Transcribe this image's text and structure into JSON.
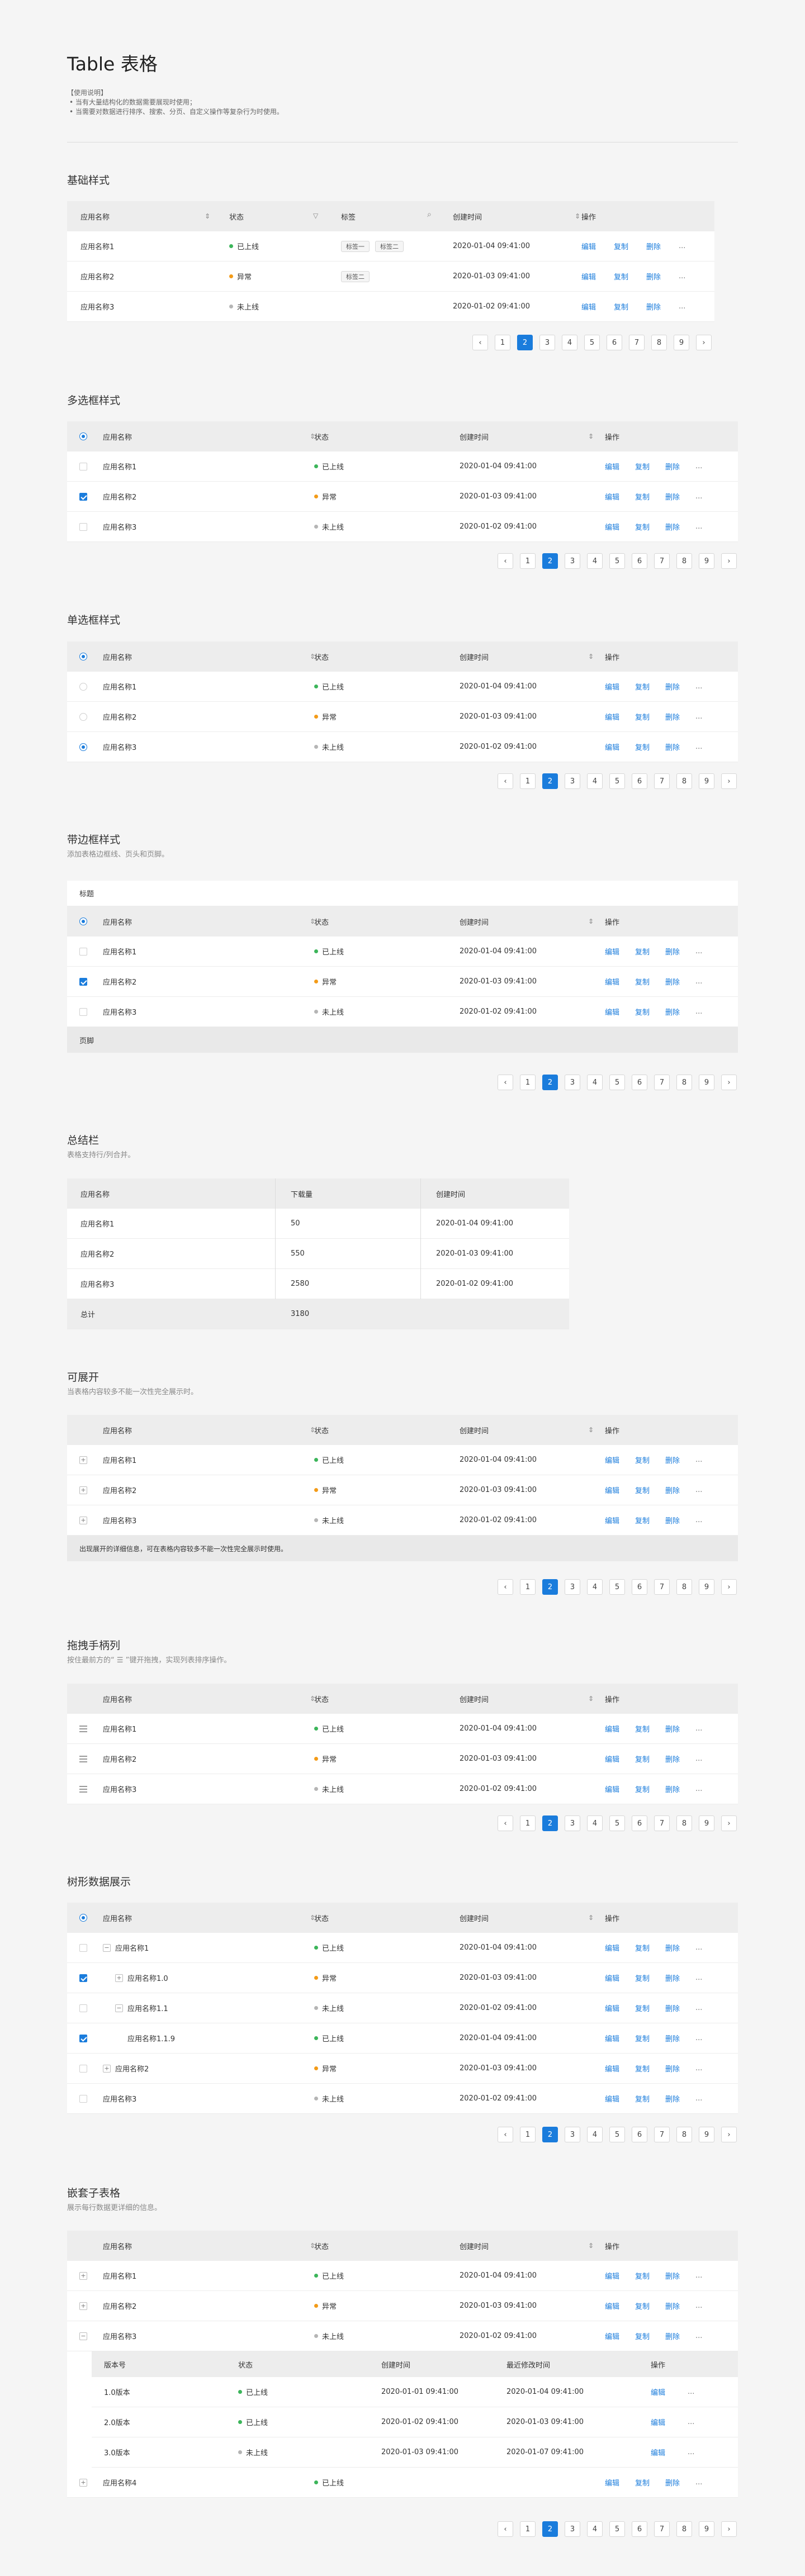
{
  "page": {
    "title": "Table 表格",
    "usage_header": "【使用说明】",
    "usage_items": [
      "• 当有大量结构化的数据需要展现时使用；",
      "• 当需要对数据进行排序、搜索、分页、自定义操作等复杂行为时使用。"
    ]
  },
  "columns": {
    "name": "应用名称",
    "status": "状态",
    "tags": "标签",
    "created": "创建时间",
    "actions": "操作",
    "downloads": "下载量",
    "version": "版本号",
    "last_modified": "最近修改时间"
  },
  "actions": {
    "edit": "编辑",
    "copy": "复制",
    "delete": "删除",
    "more": "..."
  },
  "status": {
    "online": "已上线",
    "error": "异常",
    "offline": "未上线"
  },
  "rows": [
    {
      "name": "应用名称1",
      "status": "已上线",
      "created": "2020-01-04  09:41:00"
    },
    {
      "name": "应用名称2",
      "status": "异常",
      "created": "2020-01-03  09:41:00"
    },
    {
      "name": "应用名称3",
      "status": "未上线",
      "created": "2020-01-02  09:41:00"
    }
  ],
  "tags": {
    "tag1": "标签一",
    "tag2": "标签二"
  },
  "pagination": [
    "1",
    "2",
    "3",
    "4",
    "5",
    "6",
    "7",
    "8",
    "9"
  ],
  "pagination_current": "2",
  "sections": {
    "basic": {
      "title": "基础样式"
    },
    "checkbox": {
      "title": "多选框样式"
    },
    "radio": {
      "title": "单选框样式"
    },
    "bordered": {
      "title": "带边框样式",
      "subtitle": "添加表格边框线、页头和页脚。",
      "caption": "标题",
      "footer": "页脚"
    },
    "summary": {
      "title": "总结栏",
      "subtitle": "表格支持行/列合并。",
      "rows": [
        {
          "name": "应用名称1",
          "downloads": "50",
          "created": "2020-01-04  09:41:00"
        },
        {
          "name": "应用名称2",
          "downloads": "550",
          "created": "2020-01-03  09:41:00"
        },
        {
          "name": "应用名称3",
          "downloads": "2580",
          "created": "2020-01-02  09:41:00"
        }
      ],
      "total_label": "总计",
      "total_value": "3180"
    },
    "expandable": {
      "title": "可展开",
      "subtitle": "当表格内容较多不能一次性完全展示时。",
      "detail": "出现展开的详细信息，可在表格内容较多不能一次性完全展示时使用。"
    },
    "drag": {
      "title": "拖拽手柄列",
      "subtitle": "按住最前方的“ ☰ ”键开拖拽，实现列表排序操作。"
    },
    "tree": {
      "title": "树形数据展示",
      "rows": [
        {
          "name": "应用名称1",
          "status": "已上线",
          "created": "2020-01-04  09:41:00"
        },
        {
          "name": "应用名称1.0",
          "status": "异常",
          "created": "2020-01-03  09:41:00"
        },
        {
          "name": "应用名称1.1",
          "status": "未上线",
          "created": "2020-01-02  09:41:00"
        },
        {
          "name": "应用名称1.1.9",
          "status": "已上线",
          "created": "2020-01-04  09:41:00"
        },
        {
          "name": "应用名称2",
          "status": "异常",
          "created": "2020-01-03  09:41:00"
        },
        {
          "name": "应用名称3",
          "status": "未上线",
          "created": "2020-01-02  09:41:00"
        }
      ]
    },
    "nested": {
      "title": "嵌套子表格",
      "subtitle": "展示每行数据更详细的信息。",
      "sub_rows": [
        {
          "version": "1.0版本",
          "status": "已上线",
          "created": "2020-01-01  09:41:00",
          "modified": "2020-01-04  09:41:00"
        },
        {
          "version": "2.0版本",
          "status": "已上线",
          "created": "2020-01-02  09:41:00",
          "modified": "2020-01-03  09:41:00"
        },
        {
          "version": "3.0版本",
          "status": "未上线",
          "created": "2020-01-03  09:41:00",
          "modified": "2020-01-07  09:41:00"
        }
      ],
      "row4": {
        "name": "应用名称4",
        "status": "已上线"
      }
    }
  },
  "colors": {
    "primary": "#1a7cdc",
    "online": "#3cb55a",
    "error": "#f39b18",
    "offline": "#b5b5b5"
  }
}
